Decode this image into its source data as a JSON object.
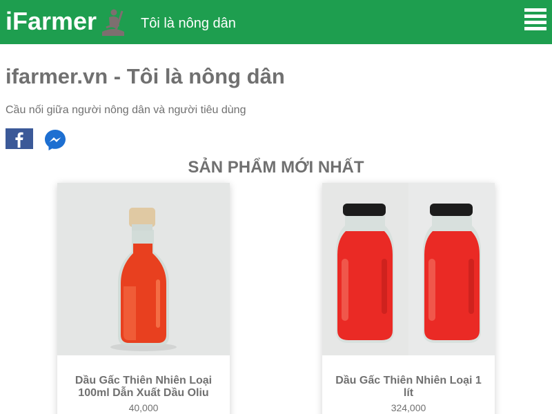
{
  "header": {
    "brand": "iFarmer",
    "tagline": "Tôi là nông dân",
    "logo_icon": "farmer-hoe-icon",
    "menu_icon": "hamburger-menu-icon",
    "background_color": "#1e9e4f"
  },
  "site": {
    "title": "ifarmer.vn - Tôi là nông dân",
    "description": "Cầu nối giữa người nông dân và người tiêu dùng"
  },
  "social": [
    {
      "name": "facebook",
      "icon": "facebook-icon",
      "color": "#3b5998"
    },
    {
      "name": "messenger",
      "icon": "messenger-icon",
      "color": "#1d6fd1"
    }
  ],
  "section": {
    "title": "SẢN PHẨM MỚI NHẤT"
  },
  "products": [
    {
      "name": "Dầu Gấc Thiên Nhiên Loại 100ml Dẫn Xuất Dầu Oliu",
      "price": "40,000",
      "image": "small-cork-bottle-red-oil"
    },
    {
      "name": "Dầu Gấc Thiên Nhiên Loại 1 lít",
      "price": "324,000",
      "image": "two-jars-red-oil"
    }
  ]
}
